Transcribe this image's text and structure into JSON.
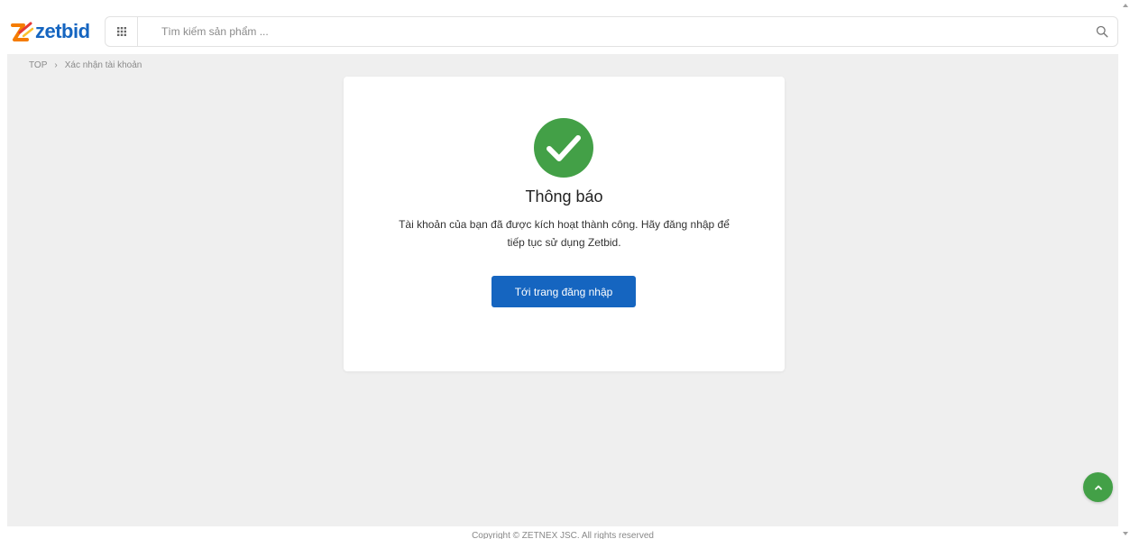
{
  "brand": {
    "name": "zetbid",
    "logo_color": "#1565c0",
    "accent_orange": "#f57c00"
  },
  "header": {
    "menu_icon": "grid-icon",
    "search": {
      "placeholder": "Tìm kiếm sản phẩm ...",
      "value": "",
      "icon": "search-icon"
    }
  },
  "breadcrumb": {
    "home": "TOP",
    "current": "Xác nhận tài khoản"
  },
  "notice": {
    "icon": "check-circle-icon",
    "icon_color": "#43a047",
    "title": "Thông báo",
    "message": "Tài khoản của bạn đã được kích hoạt thành công. Hãy đăng nhập để tiếp tục sử dụng Zetbid.",
    "button_label": "Tới trang đăng nhập",
    "button_color": "#1565c0"
  },
  "footer": {
    "copyright": "Copyright © ZETNEX JSC. All rights reserved"
  },
  "scroll_top": {
    "icon": "chevron-up-icon",
    "color": "#43a047"
  }
}
